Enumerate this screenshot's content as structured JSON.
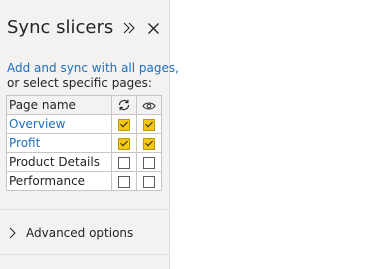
{
  "pane": {
    "title": "Sync slicers",
    "collapse_icon": "double-chevron-right-icon",
    "close_icon": "close-icon"
  },
  "instructions": {
    "link_text": "Add and sync with all pages,",
    "text": "or select specific pages:"
  },
  "table": {
    "header": {
      "page_name": "Page name",
      "sync_icon": "sync-icon",
      "visible_icon": "eye-icon"
    },
    "rows": [
      {
        "name": "Overview",
        "linked": true,
        "sync": true,
        "visible": true
      },
      {
        "name": "Profit",
        "linked": true,
        "sync": true,
        "visible": true
      },
      {
        "name": "Product Details",
        "linked": false,
        "sync": false,
        "visible": false
      },
      {
        "name": "Performance",
        "linked": false,
        "sync": false,
        "visible": false
      }
    ]
  },
  "advanced": {
    "label": "Advanced options",
    "icon": "chevron-right-icon"
  },
  "colors": {
    "link": "#1f6fbf",
    "checkbox_checked": "#f2c811",
    "pane_background": "#f3f2f1"
  }
}
